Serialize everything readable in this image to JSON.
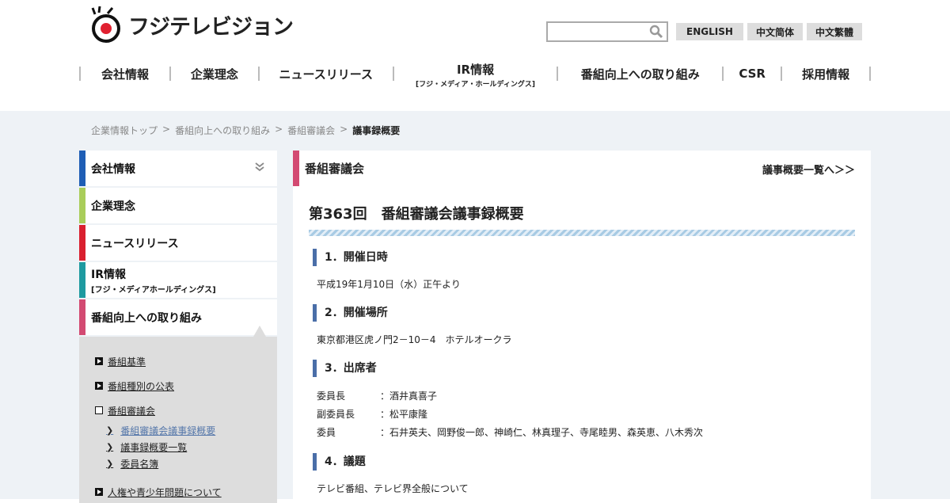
{
  "header": {
    "logo_text": "フジテレビジョン",
    "search_placeholder": "",
    "lang": [
      "ENGLISH",
      "中文简体",
      "中文繁體"
    ]
  },
  "gnav": [
    {
      "label": "会社情報"
    },
    {
      "label": "企業理念"
    },
    {
      "label": "ニュースリリース"
    },
    {
      "label": "IR情報",
      "sub": "[フジ・メディア・ホールディングス]"
    },
    {
      "label": "番組向上への取り組み"
    },
    {
      "label": "CSR"
    },
    {
      "label": "採用情報"
    }
  ],
  "breadcrumb": {
    "items": [
      "企業情報トップ",
      "番組向上への取り組み",
      "番組審議会"
    ],
    "sep": ">",
    "current": "議事録概要"
  },
  "sidebar": {
    "items": [
      {
        "label": "会社情報",
        "color": "#1f5eb5"
      },
      {
        "label": "企業理念",
        "color": "#a9cd5a"
      },
      {
        "label": "ニュースリリース",
        "color": "#d9202f"
      },
      {
        "label": "IR情報",
        "sub": "[フジ・メディアホールディングス]",
        "color": "#1e9aa0"
      },
      {
        "label": "番組向上への取り組み",
        "color": "#d34a72"
      }
    ],
    "submenu": [
      "番組基準",
      "番組種別の公表",
      "番組審議会"
    ],
    "submenu2": [
      "番組審議会議事録概要",
      "議事録概要一覧",
      "委員名簿"
    ],
    "submenu_last": "人権や青少年問題について"
  },
  "main": {
    "heading": "番組審議会",
    "link": "議事概要一覧へ＞＞",
    "title": "第363回　番組審議会議事録概要",
    "sections": [
      {
        "title": "1．開催日時",
        "text": "平成19年1月10日（水）正午より"
      },
      {
        "title": "2．開催場所",
        "text": "東京都港区虎ノ門2－10－4　ホテルオークラ"
      },
      {
        "title": "3．出席者"
      },
      {
        "title": "4．議題",
        "text": "テレビ番組、テレビ界全般について"
      }
    ],
    "attendees": [
      {
        "role": "委員長",
        "colon": "：",
        "names": "酒井真喜子"
      },
      {
        "role": "副委員長",
        "colon": "：",
        "names": "松平康隆"
      },
      {
        "role": "委員",
        "colon": "：",
        "names": "石井英夫、岡野俊一郎、神崎仁、林真理子、寺尾睦男、森英恵、八木秀次"
      }
    ]
  }
}
